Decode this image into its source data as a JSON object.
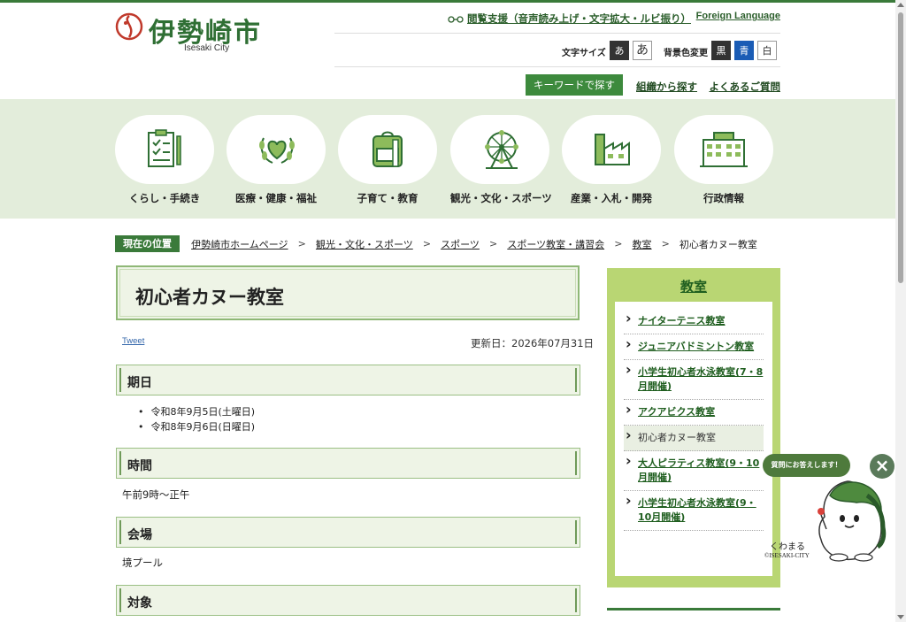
{
  "brand": {
    "name_jp": "伊勢崎市",
    "name_en": "Isesaki City",
    "color": "#2f6f34"
  },
  "header": {
    "reader_support": "閲覧支援（音声読み上げ・文字拡大・ルビ振り）",
    "foreign_language": "Foreign Language",
    "font_size_label": "文字サイズ",
    "font_size_options": [
      "あ",
      "あ"
    ],
    "bg_color_label": "背景色変更",
    "bg_color_options": [
      "黒",
      "青",
      "白"
    ],
    "keyword_search": "キーワードで探す",
    "org_search": "組織から探す",
    "faq": "よくあるご質問"
  },
  "nav": [
    {
      "label": "くらし・手続き",
      "icon": "checklist-icon"
    },
    {
      "label": "医療・健康・福祉",
      "icon": "heart-laurel-icon"
    },
    {
      "label": "子育て・教育",
      "icon": "backpack-icon"
    },
    {
      "label": "観光・文化・スポーツ",
      "icon": "ferris-wheel-icon"
    },
    {
      "label": "産業・入札・開発",
      "icon": "factory-icon"
    },
    {
      "label": "行政情報",
      "icon": "city-hall-icon"
    }
  ],
  "breadcrumb": {
    "badge": "現在の位置",
    "links": [
      "伊勢崎市ホームページ",
      "観光・文化・スポーツ",
      "スポーツ",
      "スポーツ教室・講習会",
      "教室"
    ],
    "separator": ">",
    "current": "初心者カヌー教室"
  },
  "page": {
    "title": "初心者カヌー教室",
    "tweet": "Tweet",
    "updated": "更新日：2026年07月31日",
    "sections": [
      {
        "heading": "期日",
        "items": [
          "令和8年9月5日(土曜日)",
          "令和8年9月6日(日曜日)"
        ]
      },
      {
        "heading": "時間",
        "text": "午前9時〜正午"
      },
      {
        "heading": "会場",
        "text": "境プール"
      },
      {
        "heading": "対象"
      }
    ]
  },
  "sidebar": {
    "title": "教室",
    "items": [
      {
        "label": "ナイターテニス教室",
        "current": false
      },
      {
        "label": "ジュニアバドミントン教室",
        "current": false
      },
      {
        "label": "小学生初心者水泳教室(7・8月開催)",
        "current": false
      },
      {
        "label": "アクアビクス教室",
        "current": false
      },
      {
        "label": "初心者カヌー教室",
        "current": true
      },
      {
        "label": "大人ピラティス教室(9・10月開催)",
        "current": false
      },
      {
        "label": "小学生初心者水泳教室(9・10月開催)",
        "current": false
      }
    ]
  },
  "mascot": {
    "bubble": "質問にお答えします！",
    "name": "くわまる",
    "copyright": "©ISESAKI-CITY",
    "close_icon": "close-icon"
  }
}
